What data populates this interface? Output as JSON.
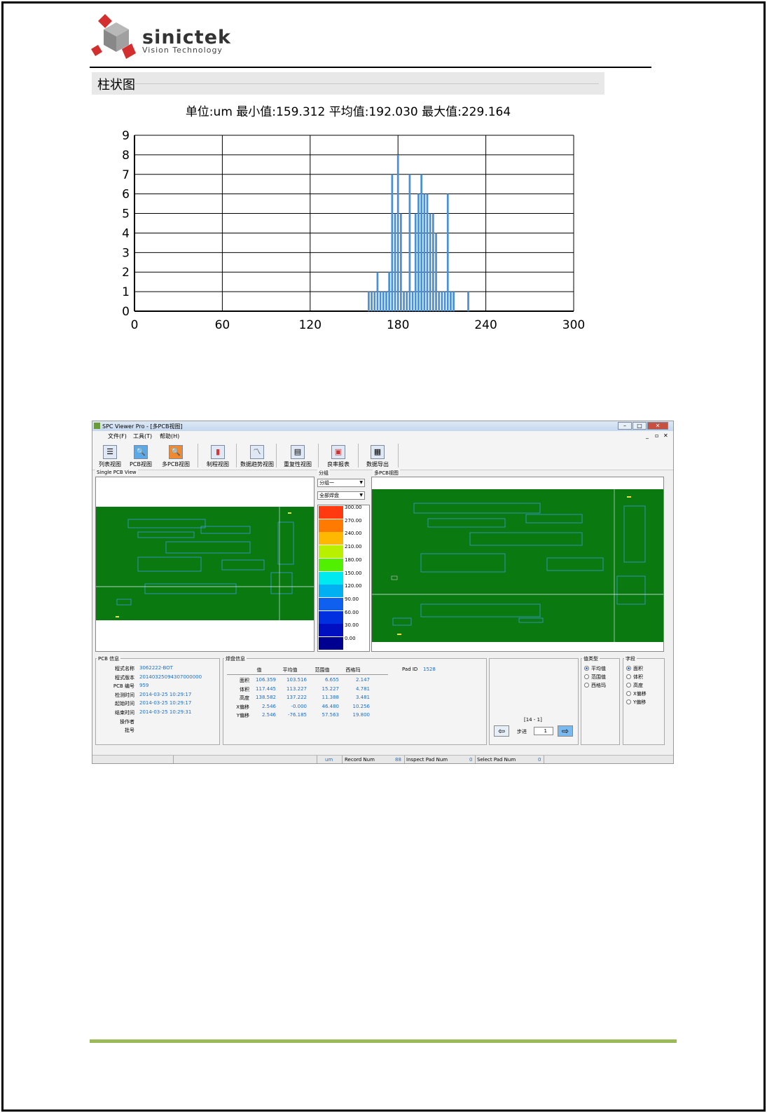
{
  "header": {
    "logo_name": "sinictek",
    "logo_sub": "Vision Technology"
  },
  "histogram": {
    "panel_title": "柱状图",
    "stats_line": "单位:um 最小值:159.312 平均值:192.030 最大值:229.164"
  },
  "chart_data": {
    "type": "bar",
    "title": "单位:um 最小值:159.312 平均值:192.030 最大值:229.164",
    "xlabel": "",
    "ylabel": "",
    "xlim": [
      0,
      300
    ],
    "ylim": [
      0,
      9
    ],
    "xticks": [
      0,
      60,
      120,
      180,
      240,
      300
    ],
    "yticks": [
      0,
      1,
      2,
      3,
      4,
      5,
      6,
      7,
      8,
      9
    ],
    "grid": true,
    "color": "#4a8fd9",
    "x": [
      160,
      162,
      164,
      166,
      168,
      170,
      172,
      174,
      176,
      178,
      180,
      182,
      184,
      186,
      188,
      190,
      192,
      194,
      196,
      198,
      200,
      202,
      204,
      206,
      208,
      210,
      212,
      214,
      216,
      218,
      220,
      228
    ],
    "values": [
      1,
      1,
      1,
      2,
      1,
      1,
      1,
      2,
      7,
      5,
      8,
      5,
      1,
      1,
      7,
      1,
      5,
      6,
      7,
      6,
      6,
      5,
      5,
      4,
      1,
      1,
      1,
      6,
      1,
      1,
      0,
      1
    ]
  },
  "app": {
    "window_title": "SPC Viewer Pro - [多PCB视图]",
    "menu": [
      "文件(F)",
      "工具(T)",
      "帮助(H)"
    ],
    "toolbar": [
      "列表视图",
      "PCB视图",
      "多PCB视图",
      "制程视图",
      "数据趋势视图",
      "重复性视图",
      "良率报表",
      "数据导出"
    ],
    "single_view_label": "Single PCB View",
    "multi_view_label": "多PCB视图",
    "group_label": "分组",
    "group_select": "分组一",
    "pad_select": "全部焊盘",
    "legend": [
      "300.00",
      "270.00",
      "240.00",
      "210.00",
      "180.00",
      "150.00",
      "120.00",
      "90.00",
      "60.00",
      "30.00",
      "0.00"
    ],
    "legend_colors": [
      "#ff3a10",
      "#ff7a00",
      "#ffb800",
      "#b8f000",
      "#50f000",
      "#00e8f0",
      "#00b0f0",
      "#1060f0",
      "#0030e0",
      "#0010c0",
      "#000090"
    ],
    "pcb_info": {
      "title": "PCB 信息",
      "rows": [
        {
          "label": "程式名称",
          "value": "3062222-BOT"
        },
        {
          "label": "程式版本",
          "value": "20140325094307000000"
        },
        {
          "label": "PCB 编号",
          "value": "959"
        },
        {
          "label": "检测时间",
          "value": "2014-03-25 10:29:17"
        },
        {
          "label": "起始时间",
          "value": "2014-03-25 10:29:17"
        },
        {
          "label": "结束时间",
          "value": "2014-03-25 10:29:31"
        },
        {
          "label": "操作者",
          "value": ""
        },
        {
          "label": "批号",
          "value": ""
        }
      ]
    },
    "pad_info": {
      "title": "焊盘信息",
      "headers": [
        "值",
        "平均值",
        "范围值",
        "西格玛"
      ],
      "rows": [
        {
          "name": "面积",
          "vals": [
            "106.359",
            "103.516",
            "6.655",
            "2.147"
          ]
        },
        {
          "name": "体积",
          "vals": [
            "117.445",
            "113.227",
            "15.227",
            "4.781"
          ]
        },
        {
          "name": "高度",
          "vals": [
            "138.582",
            "137.222",
            "11.388",
            "3.481"
          ]
        },
        {
          "name": "X偏移",
          "vals": [
            "2.546",
            "-0.000",
            "46.480",
            "10.256"
          ]
        },
        {
          "name": "Y偏移",
          "vals": [
            "2.546",
            "-76.185",
            "57.563",
            "19.800"
          ]
        }
      ],
      "pad_id_label": "Pad ID",
      "pad_id_value": "1528"
    },
    "nav": {
      "range": "[14 - 1]",
      "step_label": "步进",
      "step_value": "1"
    },
    "value_type": {
      "title": "值类型",
      "options": [
        "平均值",
        "范围值",
        "西格玛"
      ],
      "selected": 0
    },
    "field": {
      "title": "字段",
      "options": [
        "面积",
        "体积",
        "高度",
        "X偏移",
        "Y偏移"
      ],
      "selected": 0
    },
    "status": {
      "unit": "um",
      "record_label": "Record Num",
      "record_value": "88",
      "inspect_label": "Inspect Pad Num",
      "inspect_value": "0",
      "select_label": "Select Pad Num",
      "select_value": "0"
    }
  }
}
